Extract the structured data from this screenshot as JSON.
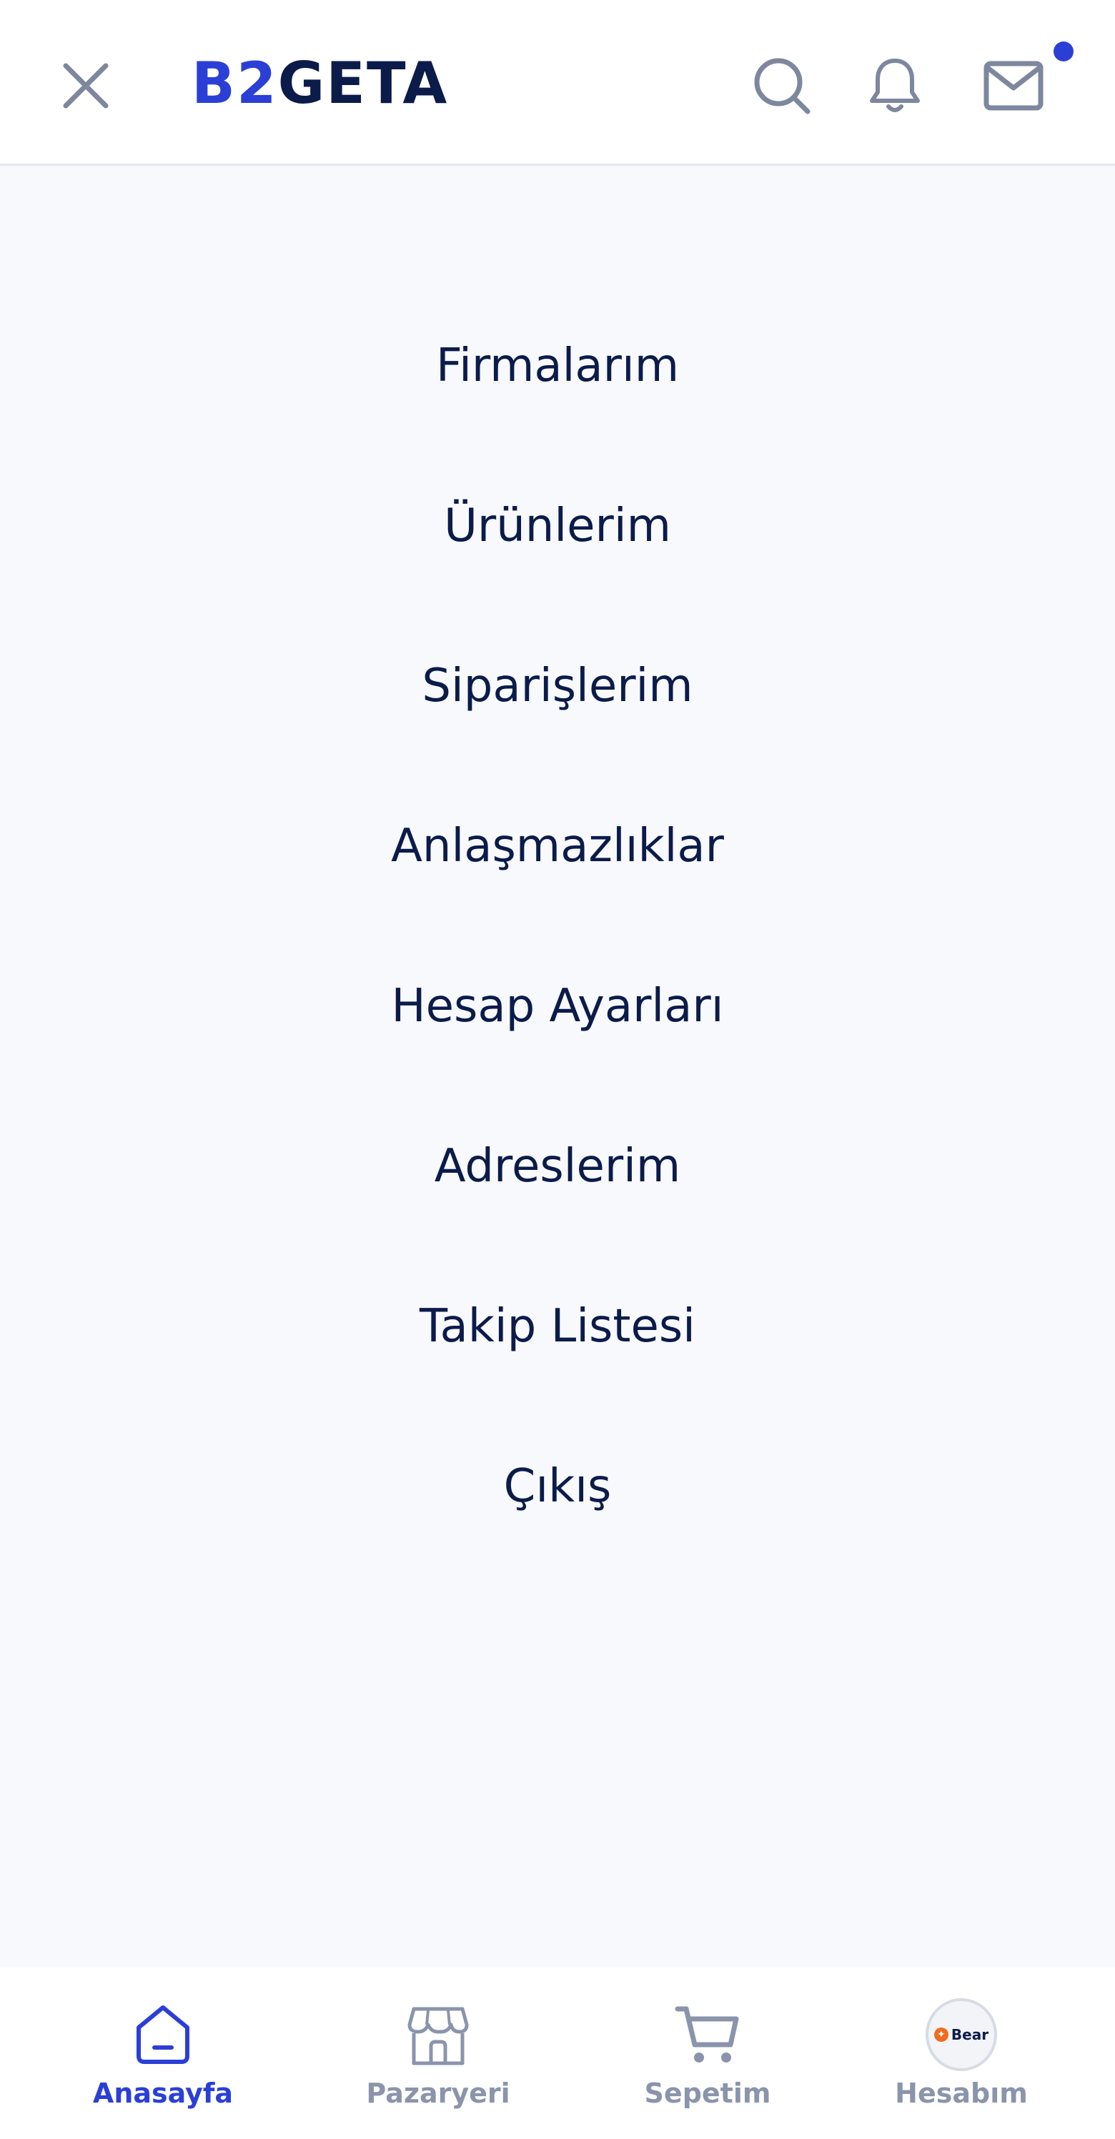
{
  "header": {
    "logo_part_1": "B2",
    "logo_part_2": "GETA",
    "icons": {
      "close": "close-icon",
      "search": "search-icon",
      "notifications": "bell-icon",
      "messages": "mail-icon"
    },
    "has_unread_messages": true
  },
  "menu": {
    "items": [
      {
        "label": "Firmalarım"
      },
      {
        "label": "Ürünlerim"
      },
      {
        "label": "Siparişlerim"
      },
      {
        "label": "Anlaşmazlıklar"
      },
      {
        "label": "Hesap Ayarları"
      },
      {
        "label": "Adreslerim"
      },
      {
        "label": "Takip Listesi"
      },
      {
        "label": "Çıkış"
      }
    ]
  },
  "bottom_nav": {
    "items": [
      {
        "label": "Anasayfa",
        "icon": "home-icon",
        "active": true
      },
      {
        "label": "Pazaryeri",
        "icon": "store-icon",
        "active": false
      },
      {
        "label": "Sepetim",
        "icon": "cart-icon",
        "active": false
      },
      {
        "label": "Hesabım",
        "icon": "avatar",
        "active": false
      }
    ],
    "avatar_text": "Bear"
  },
  "colors": {
    "brand_blue": "#2b3fd6",
    "navy": "#0b1b4a",
    "muted": "#8a94ab",
    "background": "#f8f9fc"
  }
}
